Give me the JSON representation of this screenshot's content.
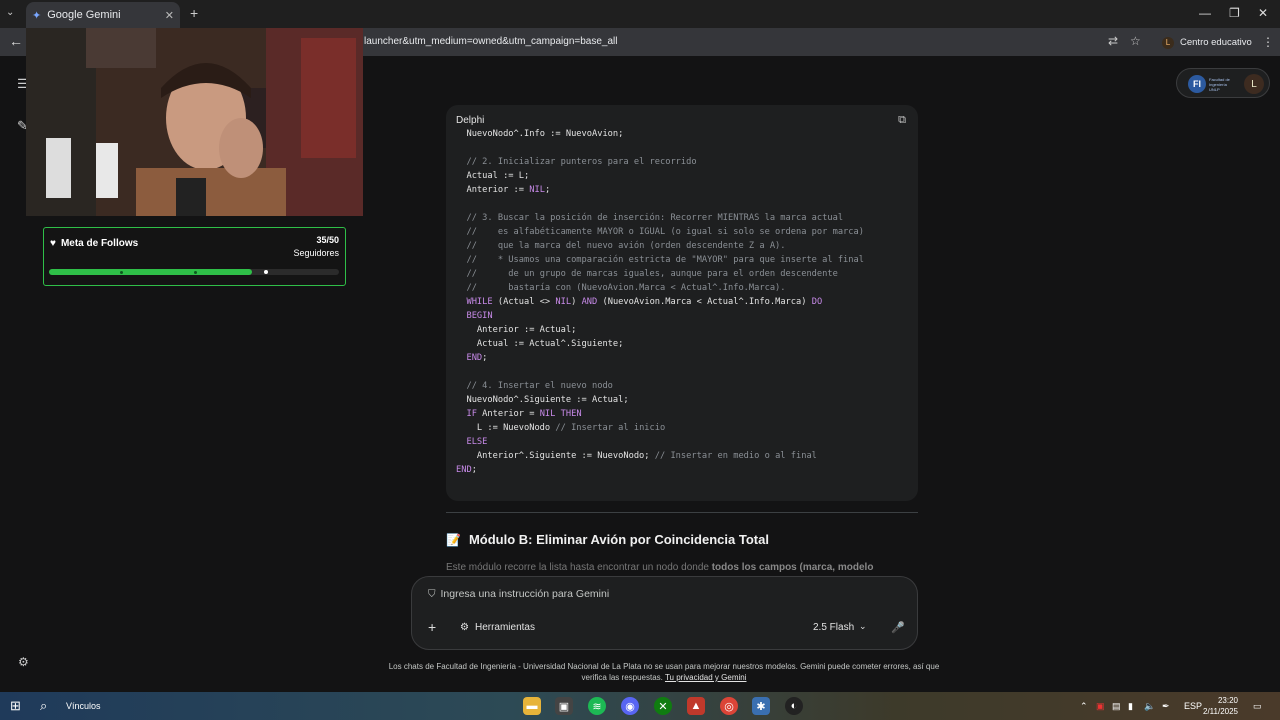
{
  "browser": {
    "tab_title": "Google Gemini",
    "url": "launcher&utm_medium=owned&utm_campaign=base_all",
    "profile_label": "Centro educativo",
    "profile_initial": "L"
  },
  "stream_overlay": {
    "widget_title": "Meta de Follows",
    "count": "35/50",
    "count_label": "Seguidores",
    "progress": 0.7
  },
  "header": {
    "logo_text": "Facultad de Ingeniería UNLP",
    "avatar_initial": "L"
  },
  "code_block": {
    "language": "Delphi",
    "lines": [
      {
        "parts": [
          {
            "t": "NuevoNodo^.Info := NuevoAvion;",
            "c": ""
          }
        ],
        "indent": "  "
      },
      {
        "parts": [],
        "indent": ""
      },
      {
        "parts": [
          {
            "t": "// 2. Inicializar punteros para el recorrido",
            "c": "cm"
          }
        ],
        "indent": "  "
      },
      {
        "parts": [
          {
            "t": "Actual := L;",
            "c": ""
          }
        ],
        "indent": "  "
      },
      {
        "parts": [
          {
            "t": "Anterior := ",
            "c": ""
          },
          {
            "t": "NIL",
            "c": "nil"
          },
          {
            "t": ";",
            "c": ""
          }
        ],
        "indent": "  "
      },
      {
        "parts": [],
        "indent": ""
      },
      {
        "parts": [
          {
            "t": "// 3. Buscar la posición de inserción: Recorrer MIENTRAS la marca actual",
            "c": "cm"
          }
        ],
        "indent": "  "
      },
      {
        "parts": [
          {
            "t": "//    es alfabéticamente MAYOR o IGUAL (o igual si solo se ordena por marca)",
            "c": "cm"
          }
        ],
        "indent": "  "
      },
      {
        "parts": [
          {
            "t": "//    que la marca del nuevo avión (orden descendente Z a A).",
            "c": "cm"
          }
        ],
        "indent": "  "
      },
      {
        "parts": [
          {
            "t": "//    * Usamos una comparación estricta de \"MAYOR\" para que inserte al final",
            "c": "cm"
          }
        ],
        "indent": "  "
      },
      {
        "parts": [
          {
            "t": "//      de un grupo de marcas iguales, aunque para el orden descendente",
            "c": "cm"
          }
        ],
        "indent": "  "
      },
      {
        "parts": [
          {
            "t": "//      bastaría con (NuevoAvion.Marca < Actual^.Info.Marca).",
            "c": "cm"
          }
        ],
        "indent": "  "
      },
      {
        "parts": [
          {
            "t": "WHILE",
            "c": "kw"
          },
          {
            "t": " (Actual <> ",
            "c": ""
          },
          {
            "t": "NIL",
            "c": "nil"
          },
          {
            "t": ") ",
            "c": ""
          },
          {
            "t": "AND",
            "c": "kw"
          },
          {
            "t": " (NuevoAvion.Marca < Actual^.Info.Marca) ",
            "c": ""
          },
          {
            "t": "DO",
            "c": "kw"
          }
        ],
        "indent": "  "
      },
      {
        "parts": [
          {
            "t": "BEGIN",
            "c": "kw"
          }
        ],
        "indent": "  "
      },
      {
        "parts": [
          {
            "t": "Anterior := Actual;",
            "c": ""
          }
        ],
        "indent": "    "
      },
      {
        "parts": [
          {
            "t": "Actual := Actual^.Siguiente;",
            "c": ""
          }
        ],
        "indent": "    "
      },
      {
        "parts": [
          {
            "t": "END",
            "c": "kw"
          },
          {
            "t": ";",
            "c": ""
          }
        ],
        "indent": "  "
      },
      {
        "parts": [],
        "indent": ""
      },
      {
        "parts": [
          {
            "t": "// 4. Insertar el nuevo nodo",
            "c": "cm"
          }
        ],
        "indent": "  "
      },
      {
        "parts": [
          {
            "t": "NuevoNodo^.Siguiente := Actual;",
            "c": ""
          }
        ],
        "indent": "  "
      },
      {
        "parts": [
          {
            "t": "IF",
            "c": "kw"
          },
          {
            "t": " Anterior = ",
            "c": ""
          },
          {
            "t": "NIL",
            "c": "nil"
          },
          {
            "t": " ",
            "c": ""
          },
          {
            "t": "THEN",
            "c": "kw"
          }
        ],
        "indent": "  "
      },
      {
        "parts": [
          {
            "t": "L := NuevoNodo ",
            "c": ""
          },
          {
            "t": "// Insertar al inicio",
            "c": "cm"
          }
        ],
        "indent": "    "
      },
      {
        "parts": [
          {
            "t": "ELSE",
            "c": "kw"
          }
        ],
        "indent": "  "
      },
      {
        "parts": [
          {
            "t": "Anterior^.Siguiente := NuevoNodo; ",
            "c": ""
          },
          {
            "t": "// Insertar en medio o al final",
            "c": "cm"
          }
        ],
        "indent": "    "
      },
      {
        "parts": [
          {
            "t": "END",
            "c": "kw"
          },
          {
            "t": ";",
            "c": ""
          }
        ],
        "indent": ""
      }
    ]
  },
  "section": {
    "icon": "memo-icon",
    "title": "Módulo B: Eliminar Avión por Coincidencia Total",
    "fade_text": "Este módulo recorre la lista hasta encontrar un nodo donde ",
    "fade_bold": "todos los campos (marca, modelo"
  },
  "input": {
    "placeholder": "Ingresa una instrucción para Gemini",
    "tools_label": "Herramientas",
    "model_label": "2.5 Flash"
  },
  "disclaimer": {
    "text": "Los chats de Facultad de Ingeniería - Universidad Nacional de La Plata no se usan para mejorar nuestros modelos. Gemini puede cometer errores, así que verifica las respuestas. ",
    "link": "Tu privacidad y Gemini"
  },
  "taskbar": {
    "search_label": "Vínculos",
    "lang": "ESP",
    "time": "23:20",
    "date": "2/11/2025"
  },
  "colors": {
    "accent_green": "#2fbf48",
    "keyword": "#c78ae8",
    "comment": "#8a8f95"
  }
}
